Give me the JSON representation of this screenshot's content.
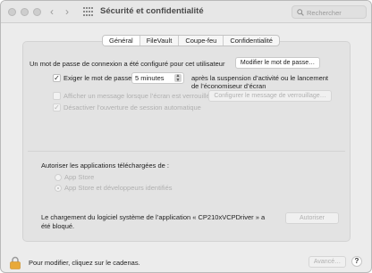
{
  "window": {
    "title": "Sécurité et confidentialité",
    "nav_back": "‹",
    "nav_forward": "›",
    "search_placeholder": "Rechercher"
  },
  "tabs": [
    {
      "label": "Général",
      "active": true
    },
    {
      "label": "FileVault",
      "active": false
    },
    {
      "label": "Coupe-feu",
      "active": false
    },
    {
      "label": "Confidentialité",
      "active": false
    }
  ],
  "general": {
    "password_text": "Un mot de passe de connexion a été configuré pour cet utilisateur",
    "change_password_button": "Modifier le mot de passe…",
    "require_password_checkbox": "✓",
    "require_password_label": "Exiger le mot de passe",
    "require_password_delay": "5 minutes",
    "require_password_suffix_line1": "après la suspension d’activité ou le lancement",
    "require_password_suffix_line2": "de l’économiseur d’écran",
    "lock_message_label": "Afficher un message lorsque l’écran est verrouillé",
    "lock_message_button": "Configurer le message de verrouillage…",
    "disable_autologin_checkbox": "✓",
    "disable_autologin_label": "Désactiver l’ouverture de session automatique"
  },
  "downloads": {
    "heading": "Autoriser les applications téléchargées de :",
    "options": [
      {
        "label": "App Store",
        "selected": false
      },
      {
        "label": "App Store et développeurs identifiés",
        "selected": true
      }
    ]
  },
  "blocked": {
    "line1": "Le chargement du logiciel système de l’application « CP210xVCPDriver » a",
    "line2": "été bloqué.",
    "allow_button": "Autoriser"
  },
  "footer": {
    "lock_text": "Pour modifier, cliquez sur le cadenas.",
    "advanced_button": "Avancé…",
    "help_button": "?"
  }
}
